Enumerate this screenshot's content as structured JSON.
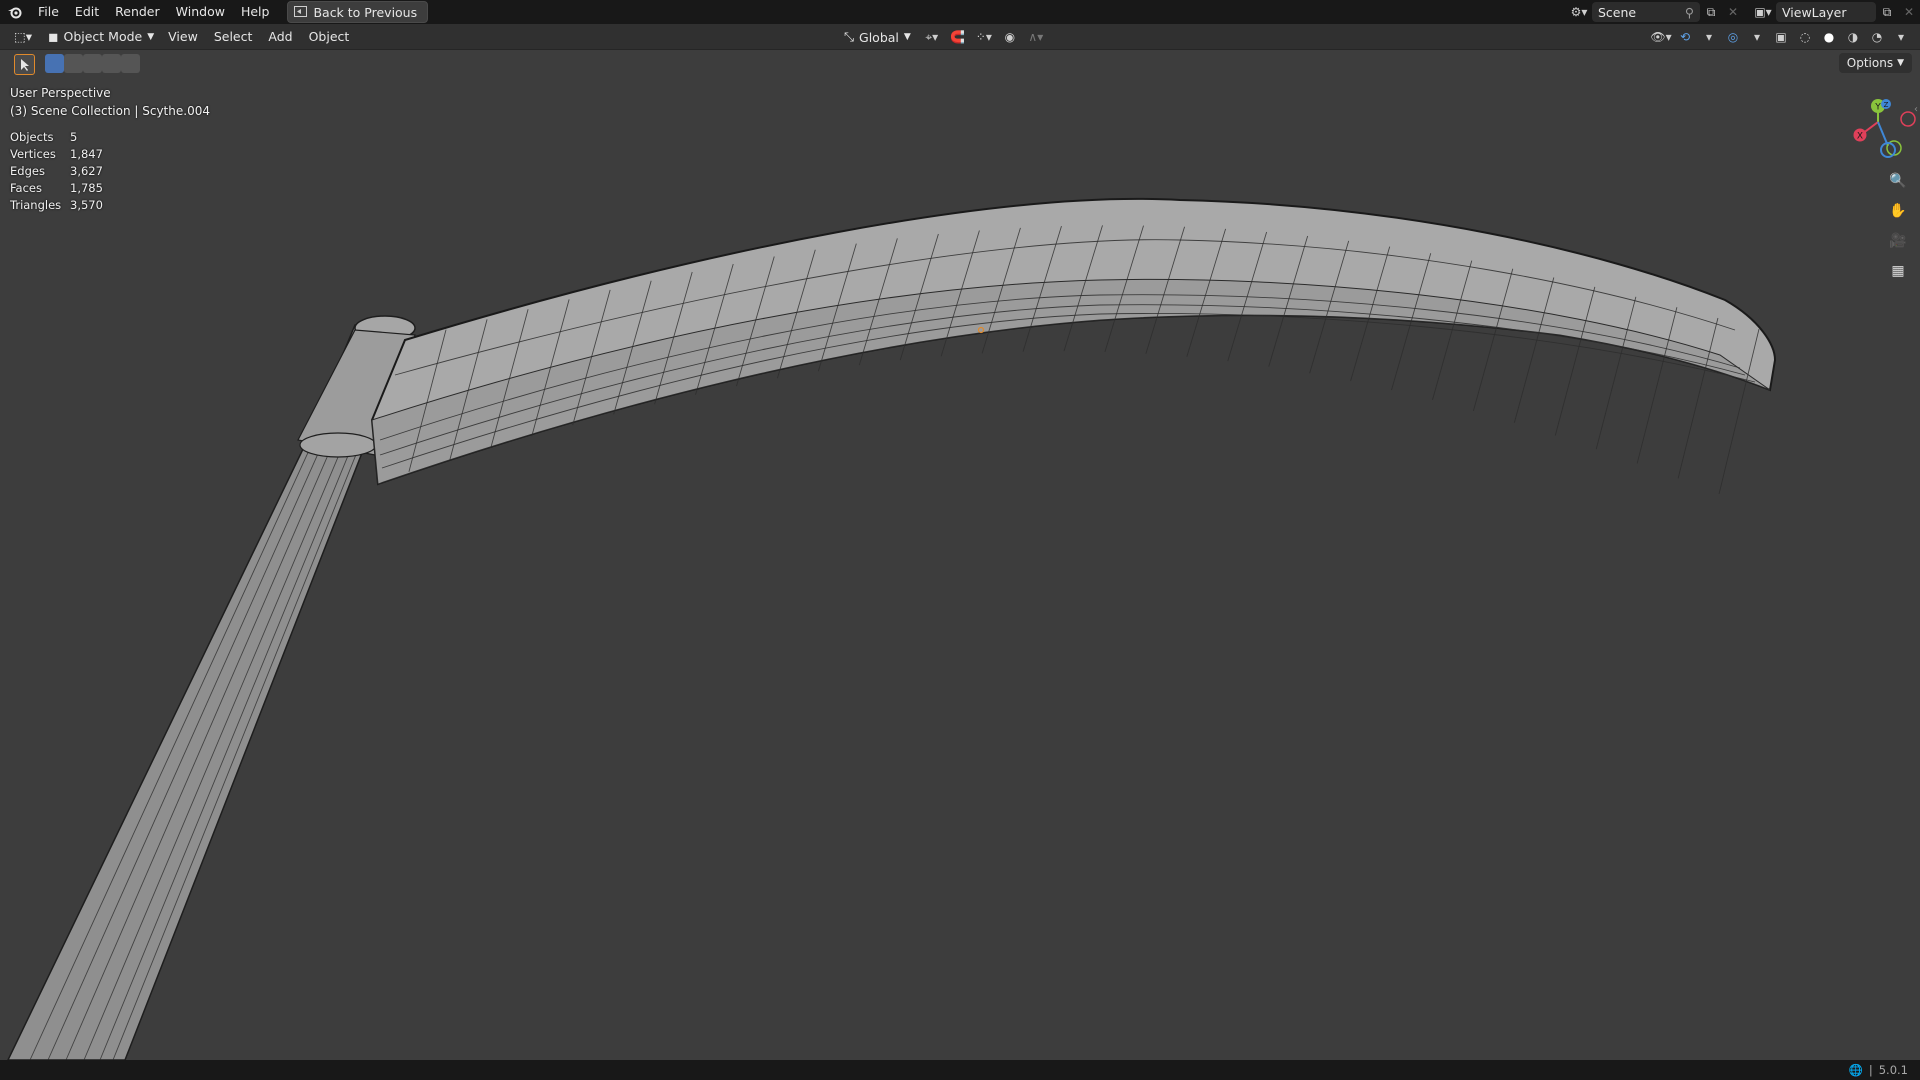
{
  "menu": {
    "items": [
      "File",
      "Edit",
      "Render",
      "Window",
      "Help"
    ],
    "back_label": "Back to Previous"
  },
  "topright": {
    "scene": "Scene",
    "view_layer": "ViewLayer"
  },
  "header": {
    "mode": "Object Mode",
    "menus": [
      "View",
      "Select",
      "Add",
      "Object"
    ],
    "orientation": "Global"
  },
  "viewport": {
    "perspective": "User Perspective",
    "collection": "(3) Scene Collection | Scythe.004",
    "options_label": "Options"
  },
  "stats": [
    {
      "label": "Objects",
      "value": "5"
    },
    {
      "label": "Vertices",
      "value": "1,847"
    },
    {
      "label": "Edges",
      "value": "3,627"
    },
    {
      "label": "Faces",
      "value": "1,785"
    },
    {
      "label": "Triangles",
      "value": "3,570"
    }
  ],
  "gizmo": {
    "x": "X",
    "y": "Y",
    "z": "Z"
  },
  "status": {
    "version": "5.0.1"
  },
  "colors": {
    "background": "#3d3d3d",
    "mesh": "#9a9a9a",
    "wire": "#1e1e1e",
    "x_axis": "#e0405a",
    "y_axis": "#8ac43c",
    "z_axis": "#3f87d6"
  }
}
